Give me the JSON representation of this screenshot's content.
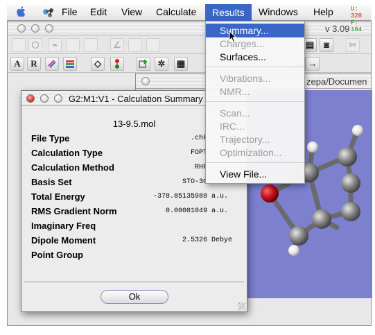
{
  "menubar": {
    "items": [
      "File",
      "Edit",
      "View",
      "Calculate",
      "Results",
      "Windows",
      "Help"
    ],
    "status_lines": [
      "U: 328",
      "F: 184"
    ],
    "status_colors": [
      "#c81e1e",
      "#1f8a1f"
    ]
  },
  "main_window": {
    "title_fragment": "v 3.09",
    "toolbar1_icons": [
      "blank-page-icon",
      "ring-icon",
      "chain-icon",
      "bond-icon",
      "measure-icon",
      "angle-icon",
      "dihedral-icon",
      "cut-icon",
      "clipboard-icon",
      "scissors-icon"
    ],
    "toolbar2_icons": [
      {
        "name": "label-a-icon",
        "glyph": "A"
      },
      {
        "name": "label-r-icon",
        "glyph": "R"
      },
      {
        "name": "stack-icon",
        "glyph": ""
      },
      {
        "name": "book-icon",
        "glyph": ""
      },
      {
        "name": "diamond-icon",
        "glyph": ""
      },
      {
        "name": "bead-icon",
        "glyph": ""
      },
      {
        "name": "add-fragment-icon",
        "glyph": ""
      },
      {
        "name": "sparkle-icon",
        "glyph": ""
      },
      {
        "name": "grid-icon",
        "glyph": ""
      }
    ]
  },
  "view_window": {
    "path_fragment": "zepa/Documen"
  },
  "calc_window": {
    "title": "G2:M1:V1 - Calculation Summary",
    "filename": "13-9.5.mol",
    "rows": [
      {
        "label": "File Type",
        "value": ".chk",
        "unit": ""
      },
      {
        "label": "Calculation Type",
        "value": "FOPT",
        "unit": ""
      },
      {
        "label": "Calculation Method",
        "value": "RHF",
        "unit": ""
      },
      {
        "label": "Basis Set",
        "value": "STO-3G",
        "unit": ""
      },
      {
        "label": "Total Energy",
        "value": "-378.85135988",
        "unit": "a.u."
      },
      {
        "label": "RMS Gradient Norm",
        "value": "0.00001049",
        "unit": "a.u."
      },
      {
        "label": "Imaginary Freq",
        "value": "",
        "unit": ""
      },
      {
        "label": "Dipole Moment",
        "value": "2.5326",
        "unit": "Debye"
      },
      {
        "label": "Point Group",
        "value": "",
        "unit": ""
      }
    ],
    "ok_label": "Ok"
  },
  "results_menu": {
    "items": [
      {
        "label": "Summary...",
        "enabled": true,
        "highlighted": true
      },
      {
        "label": "Charges...",
        "enabled": false
      },
      {
        "label": "Surfaces...",
        "enabled": true
      },
      {
        "label": "Vibrations...",
        "enabled": false
      },
      {
        "label": "NMR...",
        "enabled": false
      },
      {
        "label": "Scan...",
        "enabled": false
      },
      {
        "label": "IRC...",
        "enabled": false
      },
      {
        "label": "Trajectory...",
        "enabled": false
      },
      {
        "label": "Optimization...",
        "enabled": false
      },
      {
        "label": "View File...",
        "enabled": true
      }
    ]
  },
  "colors": {
    "menu_highlight": "#3a66c6",
    "canvas_bg": "#7d7fcf",
    "carbon": "#8a8a8a",
    "hydrogen": "#f2f2f2",
    "oxygen": "#c8141e",
    "close_button": "#e0413a",
    "ok_border": "#7d8fb0"
  }
}
